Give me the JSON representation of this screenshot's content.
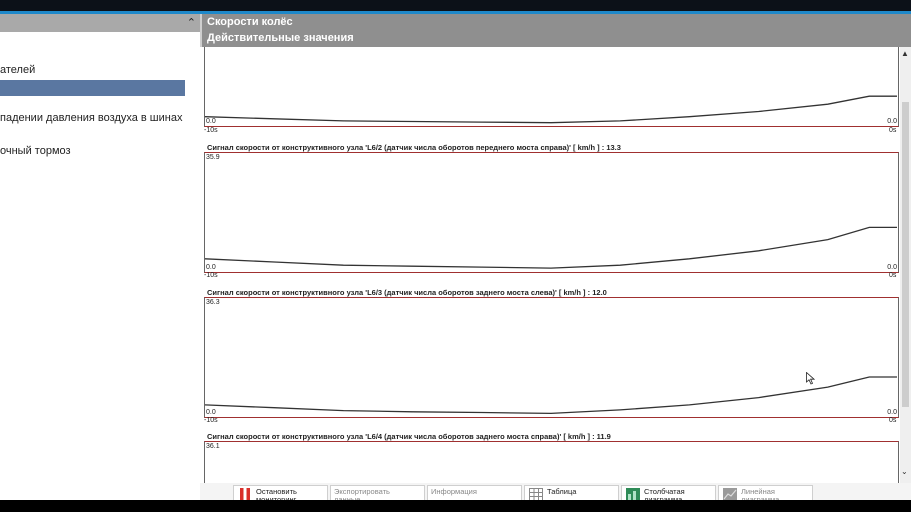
{
  "left_panel": {
    "collapse_glyph": "⌃",
    "items": [
      {
        "label": "ателей",
        "selected": false
      },
      {
        "label": "",
        "selected": true
      },
      {
        "label": "падении давления воздуха в шинах",
        "selected": false
      },
      {
        "label": "очный тормоз",
        "selected": false
      }
    ]
  },
  "header": {
    "title": "Скорости колёс",
    "subtitle": "Действительные значения"
  },
  "graphs": [
    {
      "title": "",
      "y_max": "",
      "y_min_left": "0.0",
      "y_min_right": "0.0",
      "x_left": "-10s",
      "x_right": "0s"
    },
    {
      "title": "Сигнал скорости от конструктивного узла 'L6/2 (датчик числа оборотов переднего моста справа)' [ km/h ] : 13.3",
      "y_max": "35.9",
      "y_min_left": "0.0",
      "y_min_right": "0.0",
      "x_left": "-10s",
      "x_right": "0s"
    },
    {
      "title": "Сигнал скорости от конструктивного узла 'L6/3 (датчик числа оборотов заднего моста слева)' [ km/h ] : 12.0",
      "y_max": "36.3",
      "y_min_left": "0.0",
      "y_min_right": "0.0",
      "x_left": "-10s",
      "x_right": "0s"
    },
    {
      "title": "Сигнал скорости от конструктивного узла 'L6/4 (датчик числа оборотов заднего моста справа)' [ km/h ] : 11.9",
      "y_max": "36.1",
      "y_min_left": "",
      "y_min_right": "",
      "x_left": "",
      "x_right": ""
    }
  ],
  "chart_data": [
    {
      "type": "line",
      "x": [
        -10,
        -9,
        -8,
        -7,
        -6,
        -5,
        -4,
        -3,
        -2,
        -1,
        -0.4,
        0
      ],
      "values": [
        3.5,
        2.5,
        1.5,
        1.2,
        0.9,
        0.6,
        1.5,
        3.5,
        6,
        9.5,
        13.3,
        13.3
      ],
      "ylim": [
        0,
        35.9
      ]
    },
    {
      "type": "line",
      "title": "Сигнал скорости от конструктивного узла 'L6/2 (датчик числа оборотов переднего моста справа)' [ km/h ] : 13.3",
      "x": [
        -10,
        -9,
        -8,
        -7,
        -6,
        -5,
        -4,
        -3,
        -2,
        -1,
        -0.4,
        0
      ],
      "values": [
        3.5,
        2.5,
        1.5,
        1.2,
        0.9,
        0.6,
        1.5,
        3.5,
        6,
        9.5,
        13.3,
        13.3
      ],
      "ylim": [
        0,
        35.9
      ]
    },
    {
      "type": "line",
      "title": "Сигнал скорости от конструктивного узла 'L6/3 (датчик числа оборотов заднего моста слева)' [ km/h ] : 12.0",
      "x": [
        -10,
        -9,
        -8,
        -7,
        -6,
        -5,
        -4,
        -3,
        -2,
        -1,
        -0.4,
        0
      ],
      "values": [
        3.2,
        2.3,
        1.4,
        1.0,
        0.8,
        0.5,
        1.6,
        3.2,
        5.5,
        8.8,
        12.0,
        12.0
      ],
      "ylim": [
        0,
        36.3
      ]
    }
  ],
  "toolbar": {
    "buttons": [
      {
        "label": "Остановить мониторинг",
        "icon": "stop-monitoring-icon",
        "enabled": true
      },
      {
        "label": "Экспортировать данные.",
        "icon": "",
        "enabled": false
      },
      {
        "label": "Информация",
        "icon": "",
        "enabled": false
      },
      {
        "label": "Таблица",
        "icon": "table-icon",
        "enabled": true
      },
      {
        "label": "Столбчатая диаграмма",
        "icon": "bar-chart-icon",
        "enabled": true
      },
      {
        "label": "Линейная диаграмма",
        "icon": "line-chart-icon",
        "enabled": false
      }
    ]
  },
  "scroll": {
    "up": "▲",
    "down": "⌄"
  }
}
